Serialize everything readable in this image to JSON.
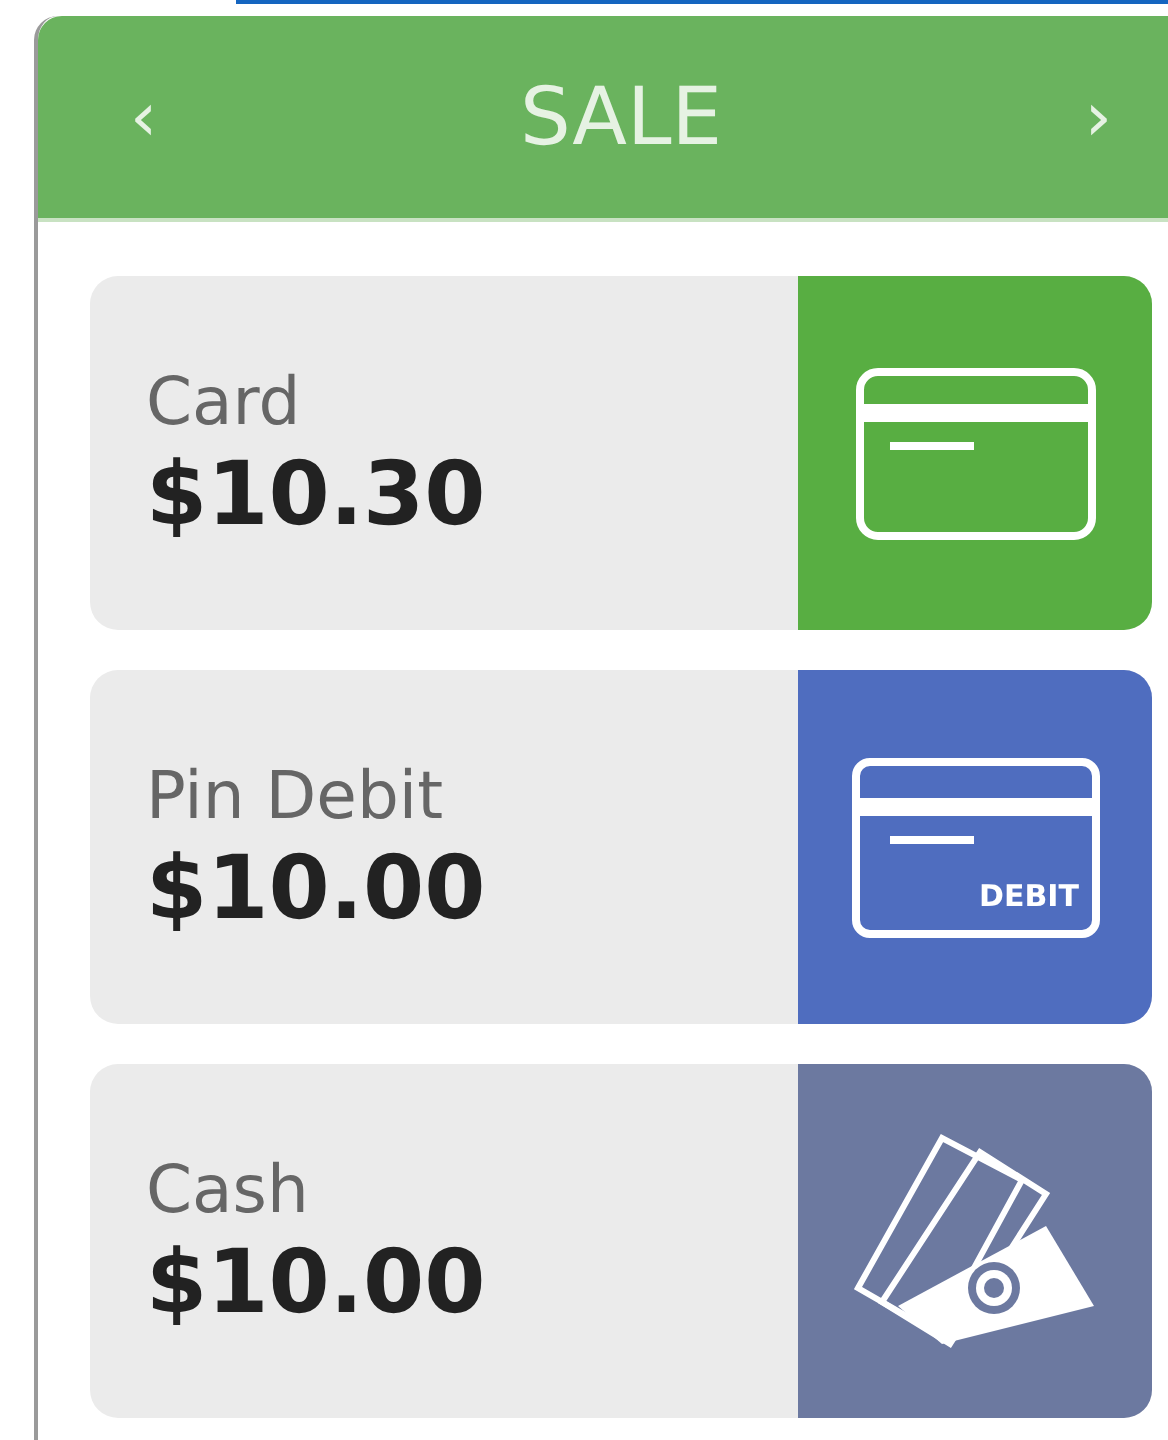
{
  "header": {
    "title": "SALE",
    "prev": "‹",
    "next": "›"
  },
  "tenders": [
    {
      "kind": "card",
      "label": "Card",
      "amount": "$10.30",
      "color": "#58ae42"
    },
    {
      "kind": "debit",
      "label": "Pin Debit",
      "amount": "$10.00",
      "color": "#4f6dbf",
      "icon_text": "DEBIT"
    },
    {
      "kind": "cash",
      "label": "Cash",
      "amount": "$10.00",
      "color": "#6c79a0"
    }
  ]
}
